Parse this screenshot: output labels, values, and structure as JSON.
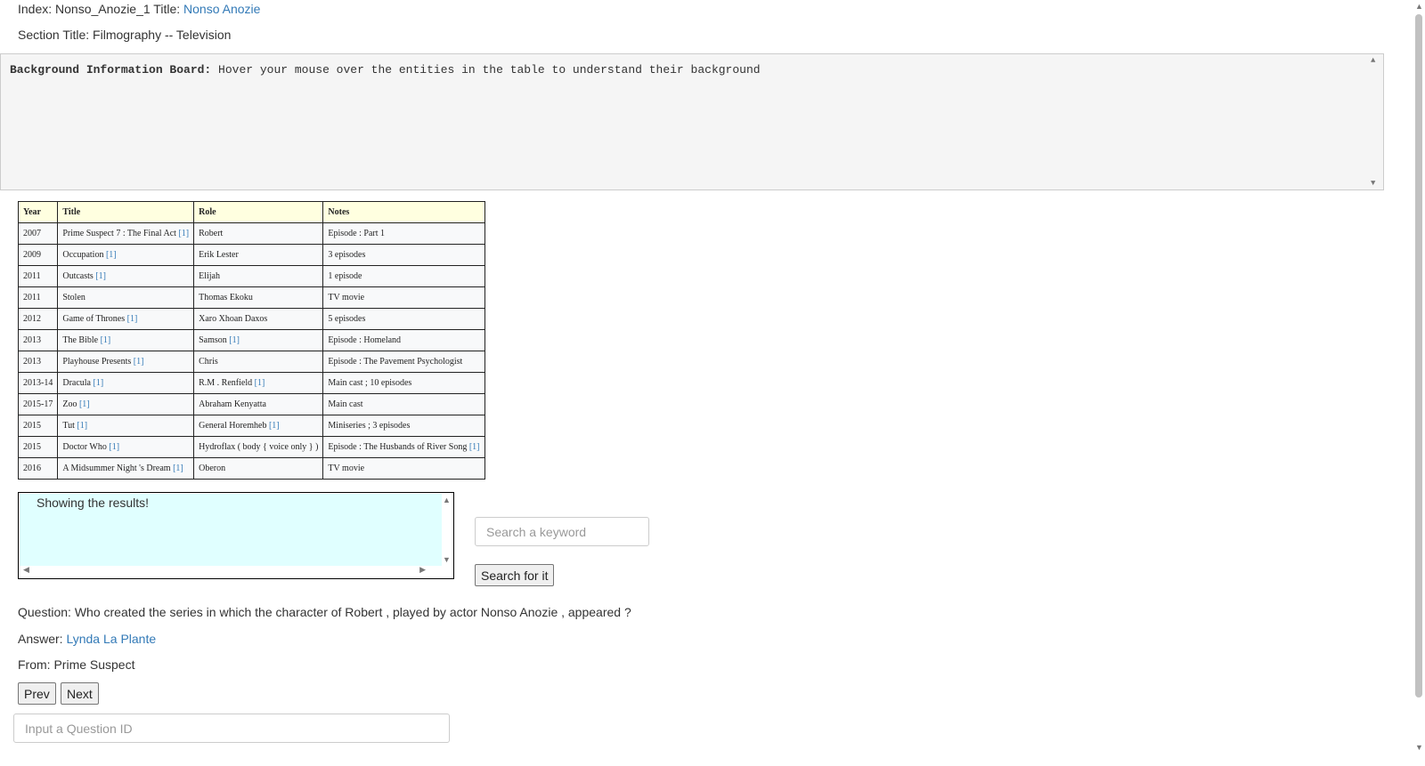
{
  "header": {
    "index_label": "Index: ",
    "index_value": "Nonso_Anozie_1",
    "title_label": " Title: ",
    "title_value": "Nonso Anozie",
    "section_label": "Section Title: ",
    "section_value": "Filmography -- Television"
  },
  "board": {
    "label": "Background Information Board:",
    "text": " Hover your mouse over the entities in the table to understand their background"
  },
  "table": {
    "headers": [
      "Year",
      "Title",
      "Role",
      "Notes"
    ],
    "ref_marker": "[1]",
    "rows": [
      {
        "year": "2007",
        "title": "Prime Suspect 7 : The Final Act",
        "title_ref": true,
        "role": "Robert",
        "role_ref": false,
        "notes": "Episode : Part 1",
        "notes_ref": false
      },
      {
        "year": "2009",
        "title": "Occupation",
        "title_ref": true,
        "role": "Erik Lester",
        "role_ref": false,
        "notes": "3 episodes",
        "notes_ref": false
      },
      {
        "year": "2011",
        "title": "Outcasts",
        "title_ref": true,
        "role": "Elijah",
        "role_ref": false,
        "notes": "1 episode",
        "notes_ref": false
      },
      {
        "year": "2011",
        "title": "Stolen",
        "title_ref": false,
        "role": "Thomas Ekoku",
        "role_ref": false,
        "notes": "TV movie",
        "notes_ref": false
      },
      {
        "year": "2012",
        "title": "Game of Thrones",
        "title_ref": true,
        "role": "Xaro Xhoan Daxos",
        "role_ref": false,
        "notes": "5 episodes",
        "notes_ref": false
      },
      {
        "year": "2013",
        "title": "The Bible",
        "title_ref": true,
        "role": "Samson",
        "role_ref": true,
        "notes": "Episode : Homeland",
        "notes_ref": false
      },
      {
        "year": "2013",
        "title": "Playhouse Presents",
        "title_ref": true,
        "role": "Chris",
        "role_ref": false,
        "notes": "Episode : The Pavement Psychologist",
        "notes_ref": false
      },
      {
        "year": "2013-14",
        "title": "Dracula",
        "title_ref": true,
        "role": "R.M . Renfield",
        "role_ref": true,
        "notes": "Main cast ; 10 episodes",
        "notes_ref": false
      },
      {
        "year": "2015-17",
        "title": "Zoo",
        "title_ref": true,
        "role": "Abraham Kenyatta",
        "role_ref": false,
        "notes": "Main cast",
        "notes_ref": false
      },
      {
        "year": "2015",
        "title": "Tut",
        "title_ref": true,
        "role": "General Horemheb",
        "role_ref": true,
        "notes": "Miniseries ; 3 episodes",
        "notes_ref": false
      },
      {
        "year": "2015",
        "title": "Doctor Who",
        "title_ref": true,
        "role": "Hydroflax ( body { voice only } )",
        "role_ref": false,
        "notes": "Episode : The Husbands of River Song",
        "notes_ref": true
      },
      {
        "year": "2016",
        "title": "A Midsummer Night 's Dream",
        "title_ref": true,
        "role": "Oberon",
        "role_ref": false,
        "notes": "TV movie",
        "notes_ref": false
      }
    ]
  },
  "results": {
    "text": "Showing the results!"
  },
  "search": {
    "placeholder": "Search a keyword",
    "button_label": "Search for it"
  },
  "qa": {
    "question_label": "Question: ",
    "question": "Who created the series in which the character of Robert , played by actor Nonso Anozie , appeared ?",
    "answer_label": "Answer: ",
    "answer": "Lynda La Plante",
    "from_label": "From: ",
    "from": "Prime Suspect"
  },
  "nav": {
    "prev_label": "Prev",
    "next_label": "Next",
    "qid_placeholder": "Input a Question ID"
  },
  "colors": {
    "link": "#337ab7",
    "table_header_bg": "#ffffe0",
    "results_bg": "#e0ffff",
    "board_bg": "#f5f5f5"
  }
}
